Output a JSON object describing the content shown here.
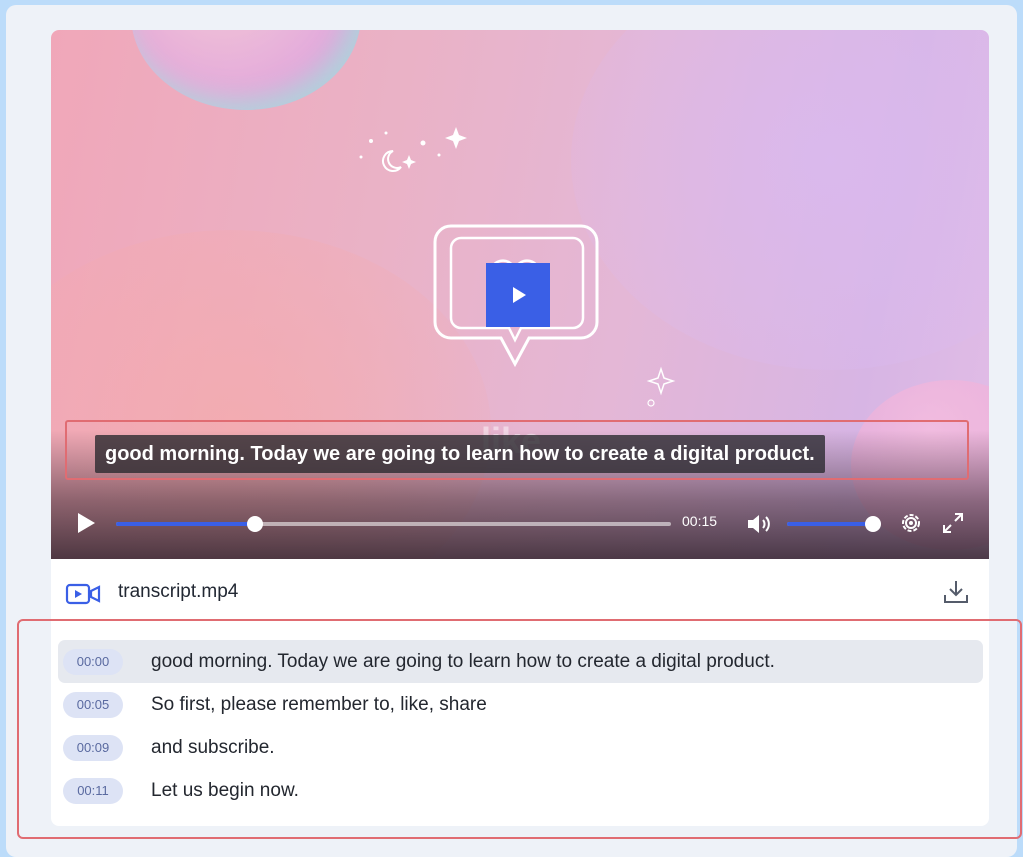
{
  "player": {
    "caption": "good morning. Today we are going to learn how to create a digital product.",
    "background_word": "like",
    "current_time": "00:15",
    "progress_fraction": 0.25,
    "volume_fraction": 1.0,
    "accent_color": "#3a5fe6",
    "icons": [
      "play-icon",
      "volume-icon",
      "settings-gear-icon",
      "fullscreen-icon"
    ]
  },
  "file": {
    "name": "transcript.mp4",
    "icon": "video-file-icon",
    "action_icon": "download-icon"
  },
  "transcript": [
    {
      "time": "00:00",
      "text": "good morning. Today we are going to learn how to create a digital product.",
      "active": true
    },
    {
      "time": "00:05",
      "text": "So first, please remember to, like, share",
      "active": false
    },
    {
      "time": "00:09",
      "text": "and subscribe.",
      "active": false
    },
    {
      "time": "00:11",
      "text": "Let us begin now.",
      "active": false
    }
  ]
}
